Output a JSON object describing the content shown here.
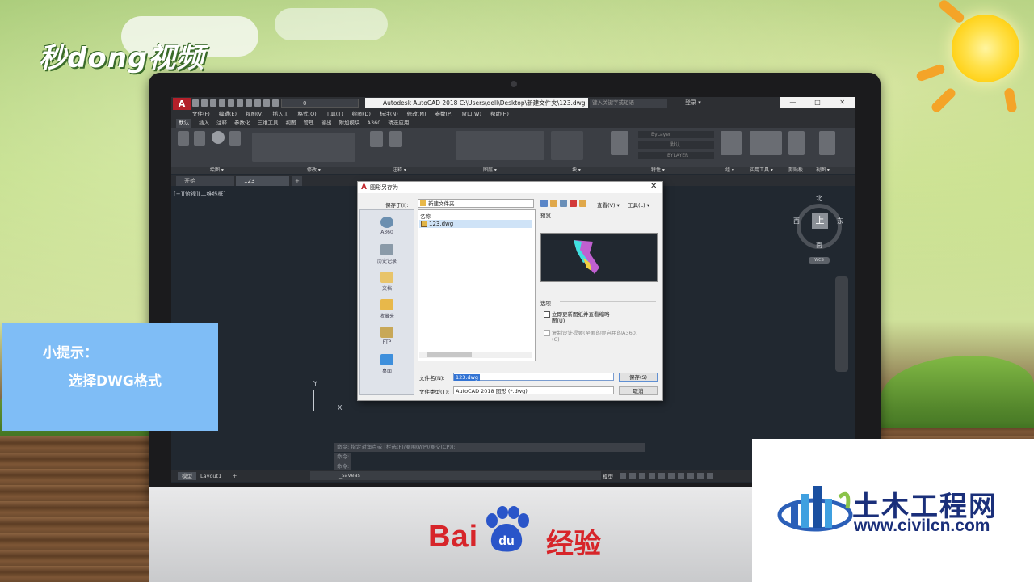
{
  "brand_top_left": "秒dong视频",
  "tip": {
    "heading": "小提示：",
    "body": "选择DWG格式"
  },
  "baidu": {
    "brand": "Bai",
    "paw_text": "du",
    "suffix": "经验"
  },
  "civil": {
    "title": "土木工程网",
    "url": "www.civilcn.com"
  },
  "acad": {
    "logo": "A",
    "layer_value": "0",
    "title": "Autodesk AutoCAD 2018   C:\\Users\\dell\\Desktop\\新建文件夹\\123.dwg",
    "search_placeholder": "键入关键字或短语",
    "login": "登录",
    "window_buttons": [
      "—",
      "□",
      "✕"
    ],
    "menu": [
      "文件(F)",
      "编辑(E)",
      "视图(V)",
      "插入(I)",
      "格式(O)",
      "工具(T)",
      "绘图(D)",
      "标注(N)",
      "修改(M)",
      "参数(P)",
      "窗口(W)",
      "帮助(H)"
    ],
    "ribbon_tabs": [
      "默认",
      "插入",
      "注释",
      "参数化",
      "三维工具",
      "视图",
      "管理",
      "输出",
      "附加模块",
      "A360",
      "精选应用"
    ],
    "ribbon_props": {
      "bylayer_1": "ByLayer",
      "bylayer_2": "默认",
      "bylayer_3": "BYLAYER"
    },
    "panel_labels": [
      "绘图 ▾",
      "修改 ▾",
      "注释 ▾",
      "图层 ▾",
      "块 ▾",
      "特性 ▾",
      "组 ▾",
      "实用工具 ▾",
      "剪贴板",
      "视图 ▾"
    ],
    "doc_tabs": [
      "开始",
      "123"
    ],
    "view_label": "[−][俯视][二维线框]",
    "viewcube": {
      "top": "上",
      "north": "北",
      "south": "南",
      "west": "西",
      "east": "东",
      "wcs": "WCS"
    },
    "ucs": {
      "x": "X",
      "y": "Y"
    },
    "command_history": [
      "命令: 指定对角点或 [栏选(F)/圈围(WP)/圈交(CP)]:",
      "命令:",
      "命令:"
    ],
    "layout_tabs": [
      "模型",
      "Layout1",
      "+"
    ],
    "command_line": "_saveas",
    "status_model": "模型"
  },
  "dialog": {
    "title": "图形另存为",
    "save_in_label": "保存于(I):",
    "save_in_value": "新建文件夹",
    "toolbar": {
      "view_label": "查看(V) ▾",
      "tools_label": "工具(L) ▾"
    },
    "places": [
      "A360",
      "历史记录",
      "文档",
      "收藏夹",
      "FTP",
      "桌面"
    ],
    "column_name": "名称",
    "files": [
      "123.dwg"
    ],
    "preview_label": "预览",
    "options_label": "选项",
    "option_1": "立即更新图纸并查看缩略图(U)",
    "option_2": "复制设计提要(至要的要启用的A360)(C)",
    "filename_label": "文件名(N):",
    "filename_value": "123.dwg",
    "filetype_label": "文件类型(T):",
    "filetype_value": "AutoCAD 2018 图形 (*.dwg)",
    "save_button": "保存(S)",
    "cancel_button": "取消"
  }
}
